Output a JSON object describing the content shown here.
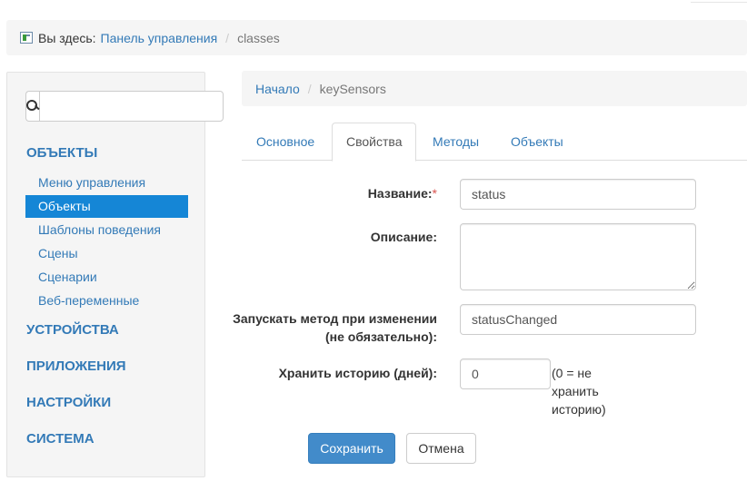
{
  "top_breadcrumb": {
    "prefix": "Вы здесь:",
    "home": "Панель управления",
    "separator": "/",
    "current": "classes"
  },
  "sidebar": {
    "search": {
      "placeholder": "",
      "value": ""
    },
    "sections": [
      {
        "label": "ОБЪЕКТЫ"
      },
      {
        "label": "УСТРОЙСТВА"
      },
      {
        "label": "ПРИЛОЖЕНИЯ"
      },
      {
        "label": "НАСТРОЙКИ"
      },
      {
        "label": "СИСТЕМА"
      }
    ],
    "items": [
      {
        "label": "Меню управления"
      },
      {
        "label": "Объекты"
      },
      {
        "label": "Шаблоны поведения"
      },
      {
        "label": "Сцены"
      },
      {
        "label": "Сценарии"
      },
      {
        "label": "Веб-переменные"
      }
    ],
    "active_item": "Объекты"
  },
  "content_breadcrumb": {
    "home": "Начало",
    "separator": "/",
    "current": "keySensors"
  },
  "tabs": [
    {
      "label": "Основное"
    },
    {
      "label": "Свойства"
    },
    {
      "label": "Методы"
    },
    {
      "label": "Объекты"
    }
  ],
  "active_tab": "Свойства",
  "form": {
    "name_label": "Название:",
    "required_mark": "*",
    "name_value": "status",
    "description_label": "Описание:",
    "description_value": "",
    "method_label_line1": "Запускать метод при изменении",
    "method_label_line2": "(не обязательно):",
    "method_value": "statusChanged",
    "history_label": "Хранить историю (дней):",
    "history_value": "0",
    "history_help_1": "(0 = не",
    "history_help_2": "хранить",
    "history_help_3": "историю)",
    "save_label": "Сохранить",
    "cancel_label": "Отмена"
  },
  "colors": {
    "link": "#337ab7",
    "active_nav": "#1586d6",
    "primary_button": "#428bca",
    "required": "#d9534f"
  },
  "icons": {
    "breadcrumb": "page-icon",
    "search": "search-icon"
  }
}
